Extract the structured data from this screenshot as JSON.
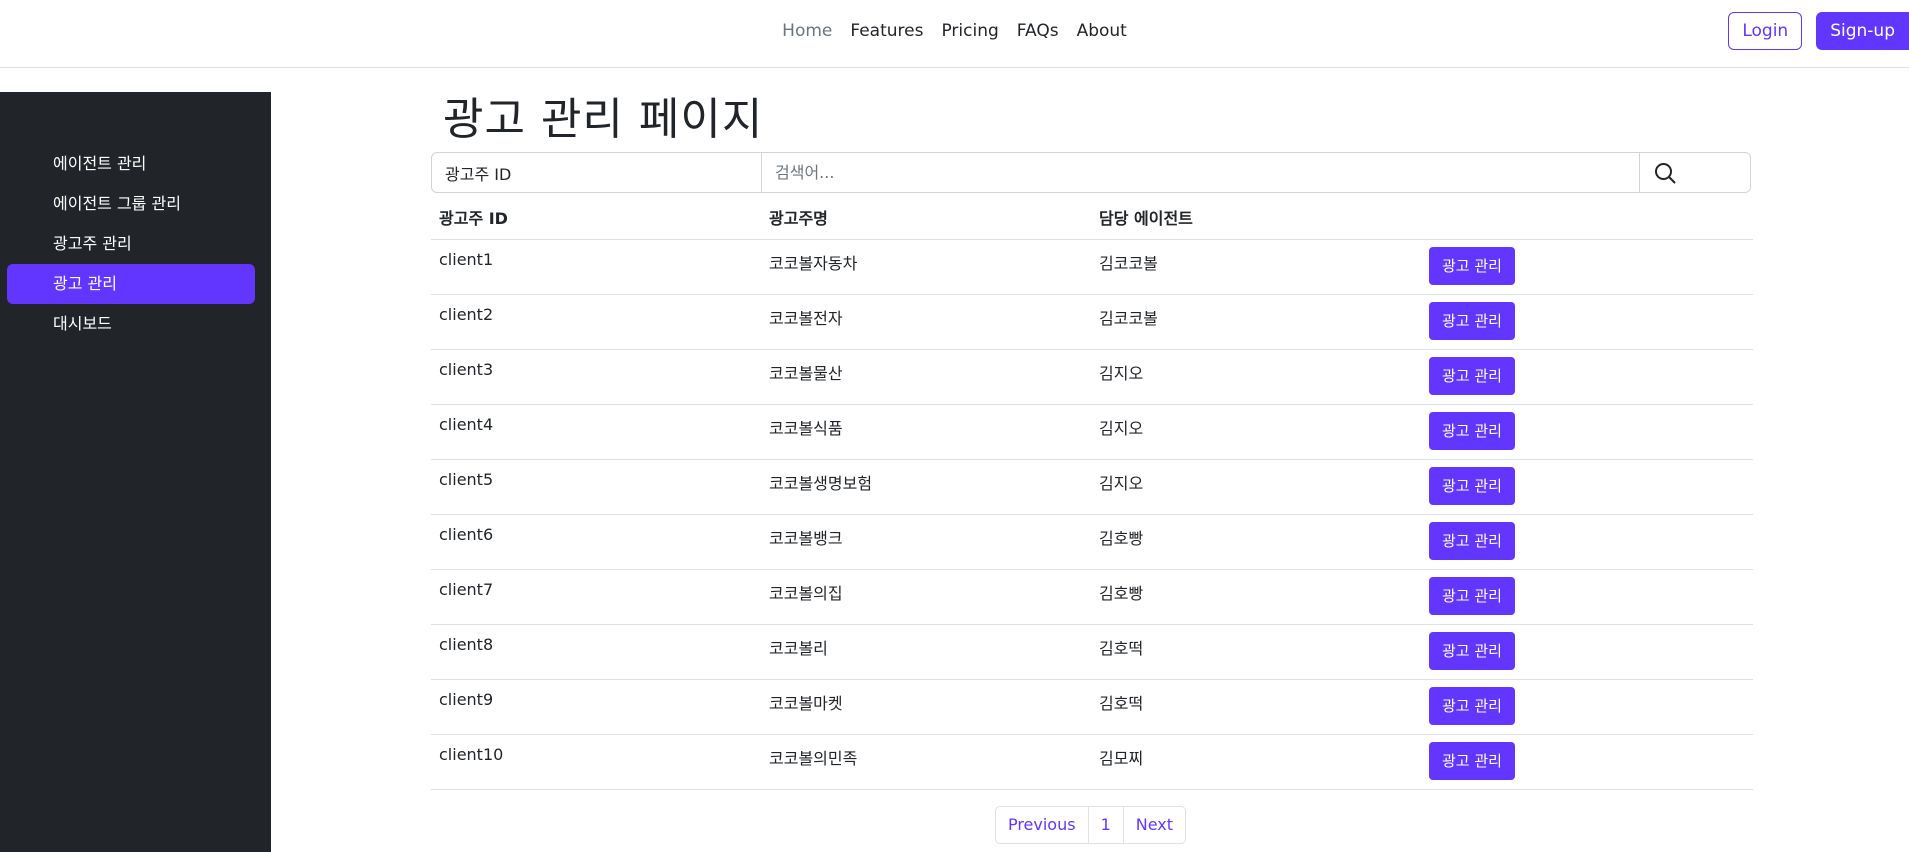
{
  "nav": {
    "items": [
      "Home",
      "Features",
      "Pricing",
      "FAQs",
      "About"
    ],
    "login": "Login",
    "signup": "Sign-up"
  },
  "sidebar": {
    "items": [
      {
        "label": "에이전트 관리"
      },
      {
        "label": "에이전트 그룹 관리"
      },
      {
        "label": "광고주 관리"
      },
      {
        "label": "광고 관리"
      },
      {
        "label": "대시보드"
      }
    ]
  },
  "page": {
    "title": "광고 관리 페이지"
  },
  "search": {
    "select_value": "광고주 ID",
    "placeholder": "검색어..."
  },
  "table": {
    "headers": [
      "광고주 ID",
      "광고주명",
      "담당 에이전트",
      ""
    ],
    "action_label": "광고 관리",
    "rows": [
      {
        "id": "client1",
        "name": "코코볼자동차",
        "agent": "김코코볼"
      },
      {
        "id": "client2",
        "name": "코코볼전자",
        "agent": "김코코볼"
      },
      {
        "id": "client3",
        "name": "코코볼물산",
        "agent": "김지오"
      },
      {
        "id": "client4",
        "name": "코코볼식품",
        "agent": "김지오"
      },
      {
        "id": "client5",
        "name": "코코볼생명보험",
        "agent": "김지오"
      },
      {
        "id": "client6",
        "name": "코코볼뱅크",
        "agent": "김호빵"
      },
      {
        "id": "client7",
        "name": "코코볼의집",
        "agent": "김호빵"
      },
      {
        "id": "client8",
        "name": "코코볼리",
        "agent": "김호떡"
      },
      {
        "id": "client9",
        "name": "코코볼마켓",
        "agent": "김호떡"
      },
      {
        "id": "client10",
        "name": "코코볼의민족",
        "agent": "김모찌"
      }
    ]
  },
  "pagination": {
    "previous": "Previous",
    "page": "1",
    "next": "Next"
  },
  "colors": {
    "accent": "#6236ff",
    "sidebar_bg": "#212529"
  },
  "icons": {
    "search": "search-icon"
  }
}
